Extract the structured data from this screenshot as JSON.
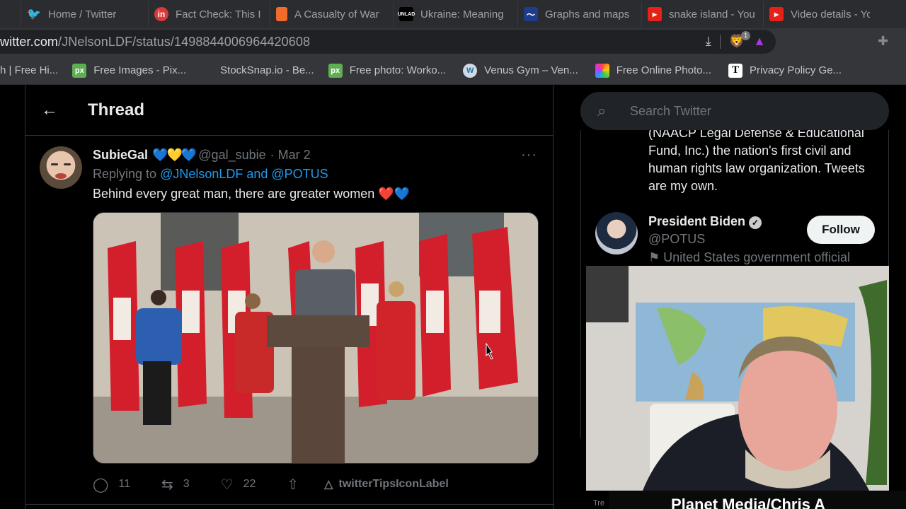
{
  "browser": {
    "tabs": [
      {
        "icon": "twitter-icon",
        "label": "Home / Twitter",
        "color": "#1d9bf0"
      },
      {
        "icon": "linkedin-icon",
        "label": "Fact Check: This I",
        "color": "#d93a3a"
      },
      {
        "icon": "bookmark-icon",
        "label": "A Casualty of War",
        "color": "#f26b2a"
      },
      {
        "icon": "unlad-icon",
        "label": "Ukraine: Meaning",
        "color": "#000000"
      },
      {
        "icon": "graph-icon",
        "label": "Graphs and maps",
        "color": "#1e3c8c"
      },
      {
        "icon": "youtube-icon",
        "label": "snake island - You",
        "color": "#e62117"
      },
      {
        "icon": "youtube-icon",
        "label": "Video details - You",
        "color": "#e62117"
      }
    ],
    "url_host": "witter.com",
    "url_path": "/JNelsonLDF/status/1498844006964420608",
    "brave_badge": "1",
    "bookmarks": [
      {
        "icon": "",
        "label": "h | Free Hi..."
      },
      {
        "icon": "pixabay-icon",
        "icon_text": "px",
        "label": "Free Images - Pix..."
      },
      {
        "icon": "",
        "label": "StockSnap.io - Be..."
      },
      {
        "icon": "pixabay-icon",
        "icon_text": "px",
        "label": "Free photo: Worko..."
      },
      {
        "icon": "wordpress-icon",
        "icon_text": "W",
        "label": "Venus Gym – Ven..."
      },
      {
        "icon": "color-wheel-icon",
        "icon_text": "",
        "label": "Free Online Photo..."
      },
      {
        "icon": "termly-icon",
        "icon_text": "T",
        "label": "Privacy Policy Ge..."
      }
    ]
  },
  "thread": {
    "title": "Thread",
    "tweet": {
      "name": "SubieGal",
      "hearts": "💙💛💙",
      "handle": "@gal_subie",
      "date": "· Mar 2",
      "replying_prefix": "Replying to ",
      "replying_mentions": "@JNelsonLDF and @POTUS",
      "text": "Behind every great man, there are greater women ❤️💙",
      "more": "···",
      "replies": "11",
      "retweets": "3",
      "likes": "22",
      "extension_label": "twitterTipsIconLabel"
    }
  },
  "sidebar": {
    "search_placeholder": "Search Twitter",
    "bio": "(NAACP Legal Defense & Educational Fund, Inc.) the nation's first civil and human rights law organization. Tweets are my own.",
    "suggestion": {
      "name": "President Biden",
      "handle": "@POTUS",
      "label": "United States government official",
      "follow": "Follow"
    }
  },
  "overlay": {
    "caption": "Planet Media/Chris A",
    "caption_prefix": "Tre"
  }
}
